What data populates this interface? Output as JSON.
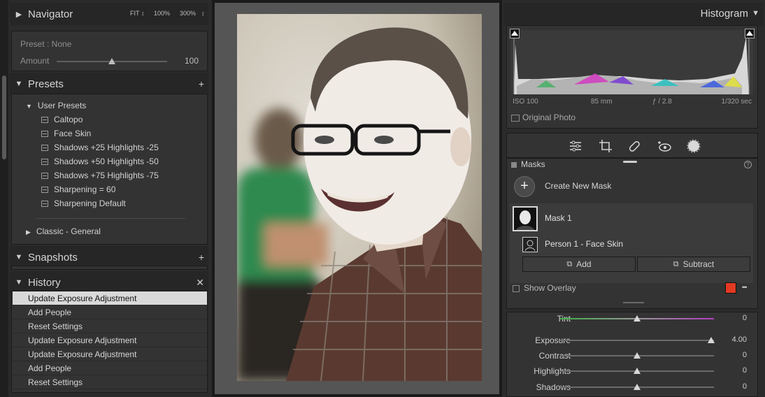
{
  "navigator": {
    "title": "Navigator",
    "zoom_fit": "FIT ↕",
    "zoom_100": "100%",
    "zoom_300": "300%",
    "zoom_more": "↕",
    "preset_label": "Preset : None",
    "amount_label": "Amount",
    "amount_value": "100",
    "amount_fraction": 0.5
  },
  "presets": {
    "title": "Presets",
    "add": "+",
    "user_group": "User Presets",
    "items": [
      "Caltopo",
      "Face Skin",
      "Shadows +25 Highlights -25",
      "Shadows +50 Highlights -50",
      "Shadows +75 Highlights -75",
      "Sharpening = 60",
      "Sharpening Default"
    ],
    "classic_group": "Classic - General"
  },
  "snapshots": {
    "title": "Snapshots",
    "add": "+"
  },
  "history": {
    "title": "History",
    "clear": "✕",
    "items": [
      "Update Exposure Adjustment",
      "Add People",
      "Reset Settings",
      "Update Exposure Adjustment",
      "Update Exposure Adjustment",
      "Add People",
      "Reset Settings"
    ]
  },
  "histogram": {
    "title": "Histogram",
    "iso": "ISO 100",
    "focal": "85 mm",
    "aperture": "ƒ / 2.8",
    "shutter": "1/320 sec",
    "original_photo": "Original Photo"
  },
  "masks": {
    "title": "Masks",
    "create_new": "Create New Mask",
    "mask1": "Mask 1",
    "component": "Person 1 - Face Skin",
    "add_label": "Add",
    "subtract_label": "Subtract",
    "show_overlay": "Show Overlay",
    "overlay_color": "#e23a22",
    "more": "•••"
  },
  "sliders": [
    {
      "label": "Tint",
      "value": "0",
      "fraction": 0.5
    },
    {
      "label": "Exposure",
      "value": "4.00",
      "fraction": 0.98
    },
    {
      "label": "Contrast",
      "value": "0",
      "fraction": 0.5
    },
    {
      "label": "Highlights",
      "value": "0",
      "fraction": 0.5
    },
    {
      "label": "Shadows",
      "value": "0",
      "fraction": 0.5
    }
  ]
}
